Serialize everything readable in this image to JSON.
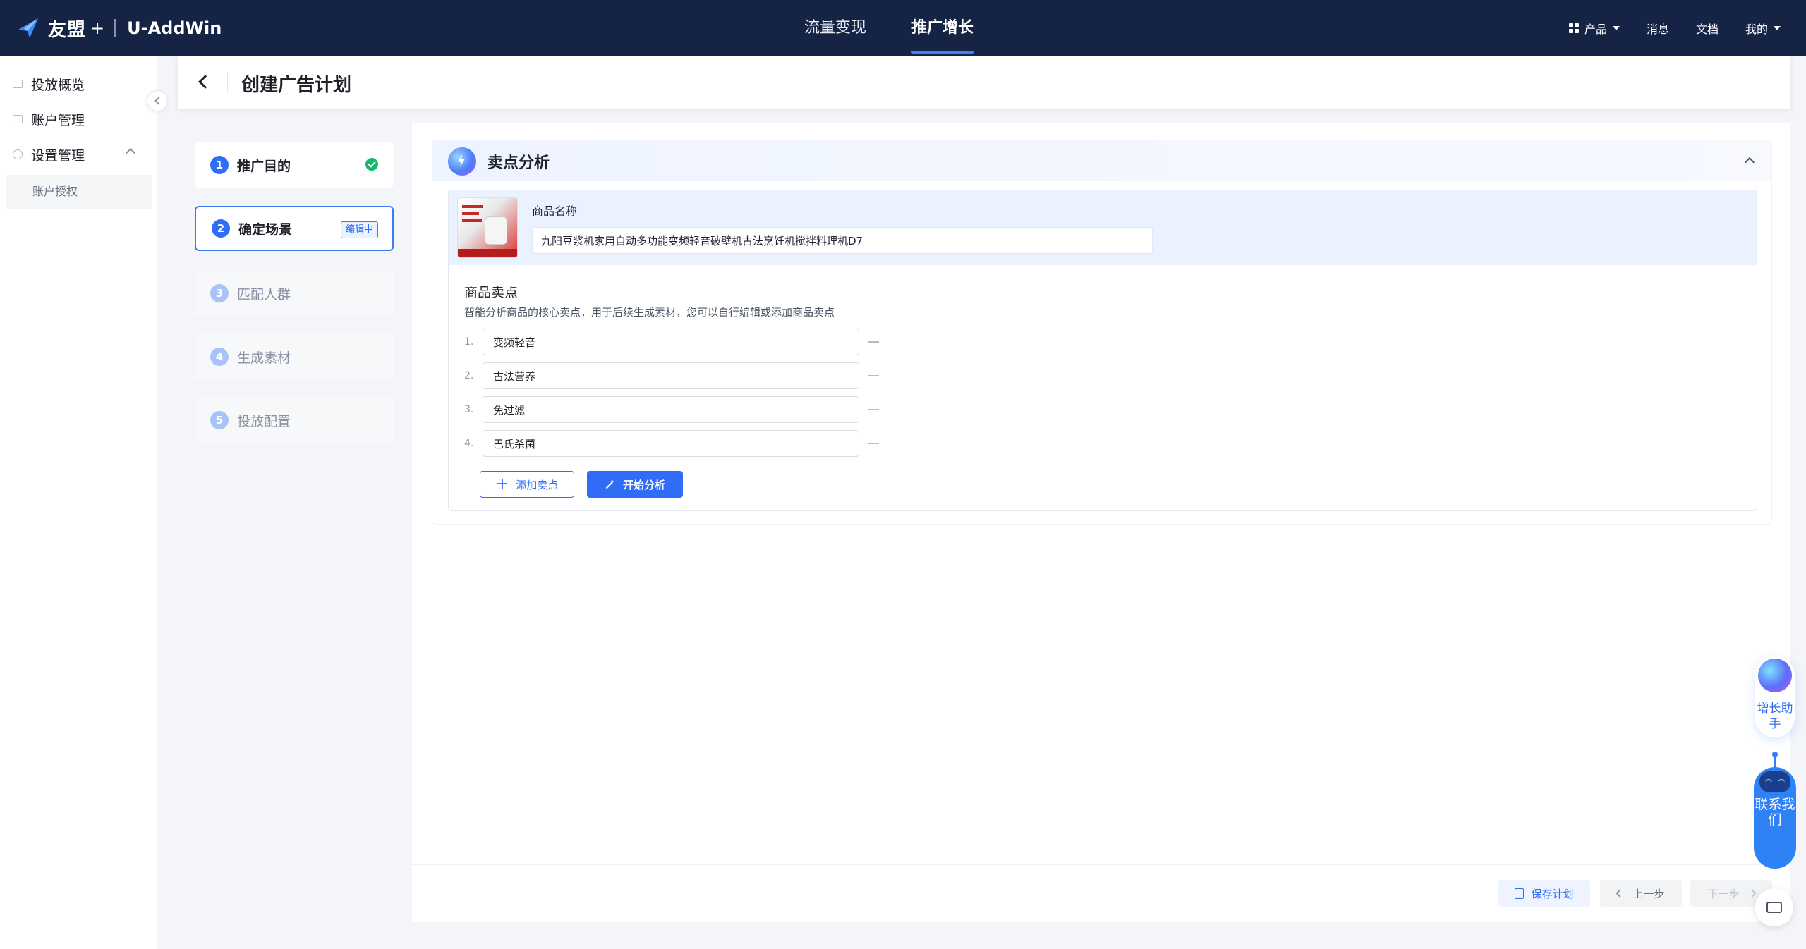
{
  "topnav": {
    "brand": "友盟",
    "brand_plus": "+",
    "brand_sub": "U-AddWin",
    "tabs": [
      {
        "label": "流量变现",
        "active": false
      },
      {
        "label": "推广增长",
        "active": true
      }
    ],
    "right": {
      "product": "产品",
      "messages": "消息",
      "docs": "文档",
      "mine": "我的"
    }
  },
  "sidebar": {
    "items": [
      {
        "label": "投放概览",
        "icon": "list-icon"
      },
      {
        "label": "账户管理",
        "icon": "account-icon"
      },
      {
        "label": "设置管理",
        "icon": "gear-icon"
      }
    ],
    "sub_items": [
      {
        "label": "账户授权"
      }
    ]
  },
  "header": {
    "title": "创建广告计划"
  },
  "steps": [
    {
      "number": "1",
      "label": "推广目的",
      "status": "done"
    },
    {
      "number": "2",
      "label": "确定场景",
      "status": "active",
      "badge": "编辑中"
    },
    {
      "number": "3",
      "label": "匹配人群",
      "status": "pending"
    },
    {
      "number": "4",
      "label": "生成素材",
      "status": "pending"
    },
    {
      "number": "5",
      "label": "投放配置",
      "status": "pending"
    }
  ],
  "analysis": {
    "title": "卖点分析",
    "product_name_label": "商品名称",
    "product_name_value": "九阳豆浆机家用自动多功能变频轻音破壁机古法烹饪机搅拌料理机D7",
    "selling_points_title": "商品卖点",
    "selling_points_desc": "智能分析商品的核心卖点，用于后续生成素材，您可以自行编辑或添加商品卖点",
    "selling_points": [
      {
        "index": "1.",
        "value": "变频轻音"
      },
      {
        "index": "2.",
        "value": "古法营养"
      },
      {
        "index": "3.",
        "value": "免过滤"
      },
      {
        "index": "4.",
        "value": "巴氏杀菌"
      }
    ],
    "add_button": "添加卖点",
    "analyze_button": "开始分析"
  },
  "footer": {
    "save": "保存计划",
    "prev": "上一步",
    "next": "下一步"
  },
  "widgets": {
    "assistant": "增长助手",
    "contact": "联系我们"
  },
  "colors": {
    "nav_bg": "#152345",
    "primary": "#2f6df6",
    "success": "#14b86b"
  }
}
